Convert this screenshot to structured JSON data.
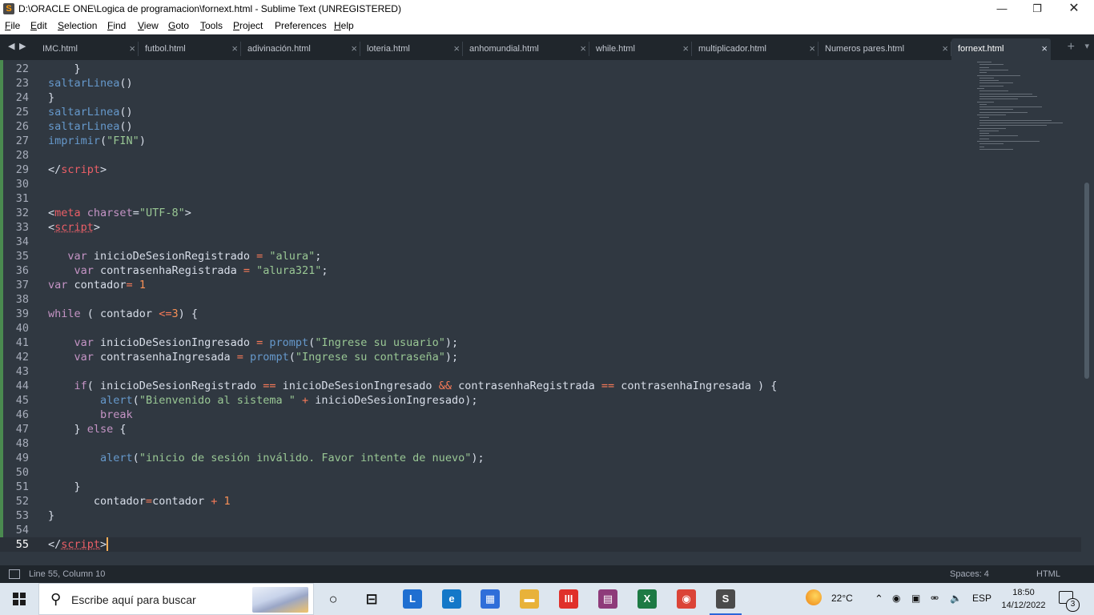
{
  "window": {
    "title": "D:\\ORACLE ONE\\Logica de programacion\\fornext.html - Sublime Text (UNREGISTERED)",
    "app_icon": "sublime-s-icon",
    "controls": [
      "minimize-icon",
      "restore-icon",
      "close-icon"
    ]
  },
  "menu": {
    "items": [
      {
        "key": "F",
        "rest": "ile"
      },
      {
        "key": "E",
        "rest": "dit"
      },
      {
        "key": "S",
        "rest": "election"
      },
      {
        "key": "F",
        "rest": "ind"
      },
      {
        "key": "V",
        "rest": "iew"
      },
      {
        "key": "G",
        "rest": "oto"
      },
      {
        "key": "T",
        "rest": "ools"
      },
      {
        "key": "P",
        "rest": "roject"
      },
      {
        "key": "",
        "rest": "Preferences"
      },
      {
        "key": "H",
        "rest": "elp"
      }
    ]
  },
  "tabs": {
    "items": [
      {
        "label": "IMC.html",
        "active": false
      },
      {
        "label": "futbol.html",
        "active": false
      },
      {
        "label": "adivinación.html",
        "active": false
      },
      {
        "label": "loteria.html",
        "active": false
      },
      {
        "label": "anhomundial.html",
        "active": false
      },
      {
        "label": "while.html",
        "active": false
      },
      {
        "label": "multiplicador.html",
        "active": false
      },
      {
        "label": "Numeros pares.html",
        "active": false
      },
      {
        "label": "fornext.html",
        "active": true
      }
    ],
    "close_glyph": "×",
    "new_tab_glyph": "+",
    "dropdown_glyph": "▾"
  },
  "editor": {
    "current_line": 55,
    "lines": [
      {
        "n": "22",
        "tokens": [
          [
            "p",
            "    }"
          ]
        ]
      },
      {
        "n": "23",
        "tokens": [
          [
            "f",
            "saltarLinea"
          ],
          [
            "p",
            "()"
          ]
        ]
      },
      {
        "n": "24",
        "tokens": [
          [
            "p",
            "}"
          ]
        ]
      },
      {
        "n": "25",
        "tokens": [
          [
            "f",
            "saltarLinea"
          ],
          [
            "p",
            "()"
          ]
        ]
      },
      {
        "n": "26",
        "tokens": [
          [
            "f",
            "saltarLinea"
          ],
          [
            "p",
            "()"
          ]
        ]
      },
      {
        "n": "27",
        "tokens": [
          [
            "f",
            "imprimir"
          ],
          [
            "p",
            "("
          ],
          [
            "s",
            "\"FIN\""
          ],
          [
            "p",
            ")"
          ]
        ]
      },
      {
        "n": "28",
        "tokens": []
      },
      {
        "n": "29",
        "tokens": [
          [
            "p",
            "</"
          ],
          [
            "t",
            "script"
          ],
          [
            "p",
            ">"
          ]
        ]
      },
      {
        "n": "30",
        "tokens": []
      },
      {
        "n": "31",
        "tokens": []
      },
      {
        "n": "32",
        "tokens": [
          [
            "p",
            "<"
          ],
          [
            "t",
            "meta"
          ],
          [
            "p",
            " "
          ],
          [
            "k",
            "charset"
          ],
          [
            "p",
            "="
          ],
          [
            "s",
            "\"UTF-8\""
          ],
          [
            "p",
            ">"
          ]
        ]
      },
      {
        "n": "33",
        "tokens": [
          [
            "p",
            "<"
          ],
          [
            "tsq",
            "script"
          ],
          [
            "p",
            ">"
          ]
        ]
      },
      {
        "n": "34",
        "tokens": []
      },
      {
        "n": "35",
        "tokens": [
          [
            "p",
            "   "
          ],
          [
            "k",
            "var"
          ],
          [
            "p",
            " inicioDeSesionRegistrado "
          ],
          [
            "o",
            "="
          ],
          [
            "p",
            " "
          ],
          [
            "s",
            "\"alura\""
          ],
          [
            "p",
            ";"
          ]
        ]
      },
      {
        "n": "36",
        "tokens": [
          [
            "p",
            "    "
          ],
          [
            "k",
            "var"
          ],
          [
            "p",
            " contrasenhaRegistrada "
          ],
          [
            "o",
            "="
          ],
          [
            "p",
            " "
          ],
          [
            "s",
            "\"alura321\""
          ],
          [
            "p",
            ";"
          ]
        ]
      },
      {
        "n": "37",
        "tokens": [
          [
            "k",
            "var"
          ],
          [
            "p",
            " contador"
          ],
          [
            "o",
            "="
          ],
          [
            "p",
            " "
          ],
          [
            "n",
            "1"
          ]
        ]
      },
      {
        "n": "38",
        "tokens": []
      },
      {
        "n": "39",
        "tokens": [
          [
            "k",
            "while"
          ],
          [
            "p",
            " ( contador "
          ],
          [
            "o",
            "<="
          ],
          [
            "n",
            "3"
          ],
          [
            "p",
            ") {"
          ]
        ]
      },
      {
        "n": "40",
        "tokens": []
      },
      {
        "n": "41",
        "tokens": [
          [
            "p",
            "    "
          ],
          [
            "k",
            "var"
          ],
          [
            "p",
            " inicioDeSesionIngresado "
          ],
          [
            "o",
            "="
          ],
          [
            "p",
            " "
          ],
          [
            "f",
            "prompt"
          ],
          [
            "p",
            "("
          ],
          [
            "s",
            "\"Ingrese su usuario\""
          ],
          [
            "p",
            ");"
          ]
        ]
      },
      {
        "n": "42",
        "tokens": [
          [
            "p",
            "    "
          ],
          [
            "k",
            "var"
          ],
          [
            "p",
            " contrasenhaIngresada "
          ],
          [
            "o",
            "="
          ],
          [
            "p",
            " "
          ],
          [
            "f",
            "prompt"
          ],
          [
            "p",
            "("
          ],
          [
            "s",
            "\"Ingrese su contraseña\""
          ],
          [
            "p",
            ");"
          ]
        ]
      },
      {
        "n": "43",
        "tokens": []
      },
      {
        "n": "44",
        "tokens": [
          [
            "p",
            "    "
          ],
          [
            "k",
            "if"
          ],
          [
            "p",
            "( inicioDeSesionRegistrado "
          ],
          [
            "o",
            "=="
          ],
          [
            "p",
            " inicioDeSesionIngresado "
          ],
          [
            "o",
            "&&"
          ],
          [
            "p",
            " contrasenhaRegistrada "
          ],
          [
            "o",
            "=="
          ],
          [
            "p",
            " contrasenhaIngresada ) {"
          ]
        ]
      },
      {
        "n": "45",
        "tokens": [
          [
            "p",
            "        "
          ],
          [
            "f",
            "alert"
          ],
          [
            "p",
            "("
          ],
          [
            "s",
            "\"Bienvenido al sistema \""
          ],
          [
            "p",
            " "
          ],
          [
            "o",
            "+"
          ],
          [
            "p",
            " inicioDeSesionIngresado);"
          ]
        ]
      },
      {
        "n": "46",
        "tokens": [
          [
            "p",
            "        "
          ],
          [
            "k",
            "break"
          ]
        ]
      },
      {
        "n": "47",
        "tokens": [
          [
            "p",
            "    } "
          ],
          [
            "k",
            "else"
          ],
          [
            "p",
            " {"
          ]
        ]
      },
      {
        "n": "48",
        "tokens": []
      },
      {
        "n": "49",
        "tokens": [
          [
            "p",
            "        "
          ],
          [
            "f",
            "alert"
          ],
          [
            "p",
            "("
          ],
          [
            "s",
            "\"inicio de sesión inválido. Favor intente de nuevo\""
          ],
          [
            "p",
            ");"
          ]
        ]
      },
      {
        "n": "50",
        "tokens": []
      },
      {
        "n": "51",
        "tokens": [
          [
            "p",
            "    }"
          ]
        ]
      },
      {
        "n": "52",
        "tokens": [
          [
            "p",
            "       contador"
          ],
          [
            "o",
            "="
          ],
          [
            "p",
            "contador "
          ],
          [
            "o",
            "+"
          ],
          [
            "p",
            " "
          ],
          [
            "n",
            "1"
          ]
        ]
      },
      {
        "n": "53",
        "tokens": [
          [
            "p",
            "}"
          ]
        ]
      },
      {
        "n": "54",
        "tokens": []
      },
      {
        "n": "55",
        "tokens": [
          [
            "p",
            "</"
          ],
          [
            "tsq",
            "script"
          ],
          [
            "p",
            ">"
          ]
        ],
        "caret": true
      }
    ]
  },
  "status": {
    "position": "Line 55, Column 10",
    "indentation": "Spaces: 4",
    "syntax": "HTML"
  },
  "taskbar": {
    "search_placeholder": "Escribe aquí para buscar",
    "pinned": [
      {
        "name": "task-view-icon",
        "glyph": "⊟"
      },
      {
        "name": "learning-app-icon",
        "glyph": "L",
        "color": "#1f6fd1"
      },
      {
        "name": "edge-icon",
        "glyph": "e",
        "color": "#1478c8"
      },
      {
        "name": "store-icon",
        "glyph": "▦",
        "color": "#2f6ed9"
      },
      {
        "name": "file-explorer-icon",
        "glyph": "▬",
        "color": "#e8b23a"
      },
      {
        "name": "red-app-icon",
        "glyph": "III",
        "color": "#e0302a"
      },
      {
        "name": "winrar-icon",
        "glyph": "▤",
        "color": "#8e3b7a"
      },
      {
        "name": "excel-icon",
        "glyph": "X",
        "color": "#1d7a44"
      },
      {
        "name": "chrome-icon",
        "glyph": "◉",
        "color": "#db4437"
      },
      {
        "name": "sublime-taskbar-icon",
        "glyph": "S",
        "color": "#4b4b4b"
      }
    ],
    "weather": "22°C",
    "language": "ESP",
    "time": "18:50",
    "date": "14/12/2022",
    "notifications": "3"
  }
}
